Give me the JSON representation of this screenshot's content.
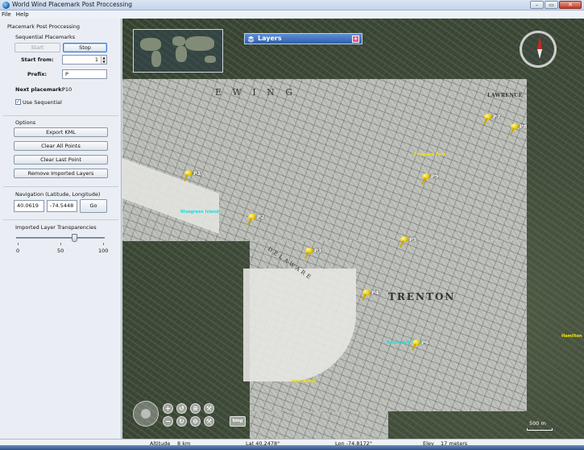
{
  "window": {
    "title": "World Wind Placemark Post Proccessing"
  },
  "menu": [
    "File",
    "Help"
  ],
  "panel": {
    "section_title": "Placemark Post Proccessing",
    "sequential_group": "Sequential Placemarks",
    "start_button": "Start",
    "stop_button": "Stop",
    "start_from_label": "Start from:",
    "start_from_value": "1",
    "prefix_label": "Prefix:",
    "prefix_value": "P",
    "next_placemark_label": "Next placemark:",
    "next_placemark_value": "P10",
    "use_sequential_label": "Use Sequential",
    "use_sequential_checked": true,
    "options_label": "Options",
    "export_kml": "Export KML",
    "clear_all_points": "Clear All Points",
    "clear_last_point": "Clear Last Point",
    "remove_imported_layers": "Remove Imported Layers",
    "navigation_label": "Navigation (Latitude, Longitude)",
    "lat_value": "40.0619",
    "lon_value": "-74.5448",
    "go_button": "Go",
    "transparency_label": "Imported Layer Transparencies",
    "transparency_value": 70,
    "slider_ticks": [
      "0",
      "50",
      "100"
    ]
  },
  "map": {
    "layers_title": "Layers",
    "map_labels": {
      "ewing": "E W I N G",
      "lawrence": "LAWRENCE",
      "trenton": "TRENTON",
      "delaware": "DELAWARE"
    },
    "placemarks": [
      "P1",
      "P2",
      "P3",
      "P4",
      "P5",
      "P6",
      "P7",
      "P8",
      "P9"
    ],
    "scale_label": "500 m"
  },
  "status": {
    "altitude_label": "Altitude",
    "altitude_value": "8 km",
    "lat": "Lat 40.2478°",
    "lon": "Lon -74.8172°",
    "elev_label": "Elev",
    "elev_value": "17 meters"
  },
  "colors": {
    "accent": "#3b7bd6",
    "placemark": "#e8c600",
    "layers_bar": "#2e5fad",
    "compass_north": "#d0261f"
  }
}
